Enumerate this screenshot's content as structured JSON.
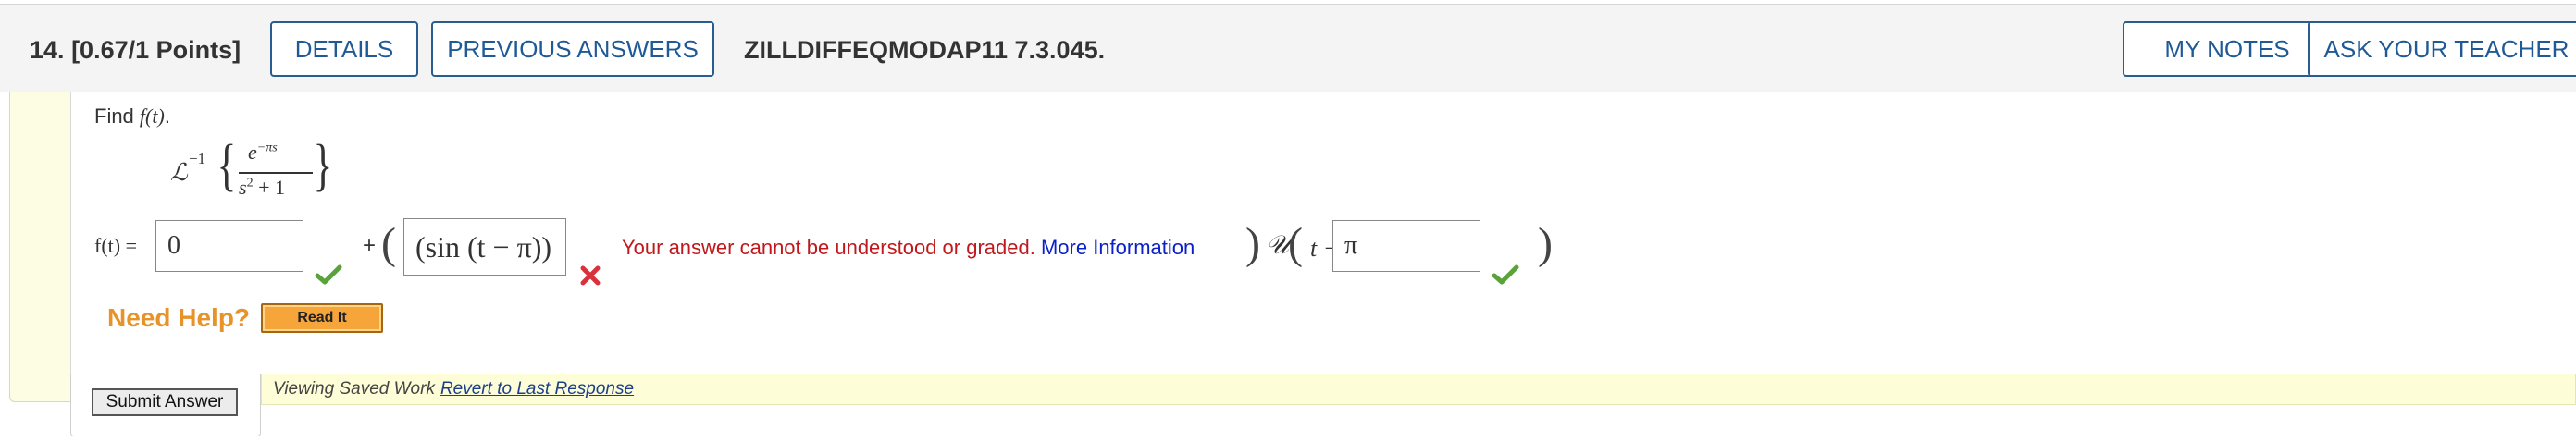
{
  "header": {
    "question_number": "14.",
    "points": "[0.67/1 Points]",
    "details_label": "DETAILS",
    "previous_answers_label": "PREVIOUS ANSWERS",
    "question_code": "ZILLDIFFEQMODAP11 7.3.045.",
    "my_notes_label": "MY NOTES",
    "ask_teacher_label": "ASK YOUR TEACHER"
  },
  "question": {
    "prompt_prefix": "Find ",
    "prompt_function": "f(t)",
    "prompt_suffix": ".",
    "laplace_symbol": "ℒ",
    "laplace_superscript": "−1",
    "numerator": "e",
    "numerator_exponent": "−πs",
    "denominator": "s",
    "denominator_exponent": "2",
    "denominator_rest": " + 1"
  },
  "answer": {
    "ft_label": "f(t) =",
    "plus": "+",
    "field1_value": "0",
    "field2_value": "(sin (t − π))",
    "error_message": "Your answer cannot be understood or graded.",
    "more_info_label": "More Information",
    "step_symbol": "𝒰",
    "t_minus": "t −",
    "field3_value": "π"
  },
  "help": {
    "need_help_label": "Need Help?",
    "read_it_label": "Read It"
  },
  "footer": {
    "submit_label": "Submit Answer",
    "saved_text": "Viewing Saved Work",
    "revert_label": "Revert to Last Response"
  },
  "colors": {
    "accent": "#1f5a96",
    "error": "#c0181c",
    "link": "#0b20c8",
    "need_help": "#e8922a",
    "read_it": "#f6a53b",
    "check": "#5aa33a",
    "cross": "#d9323c"
  }
}
